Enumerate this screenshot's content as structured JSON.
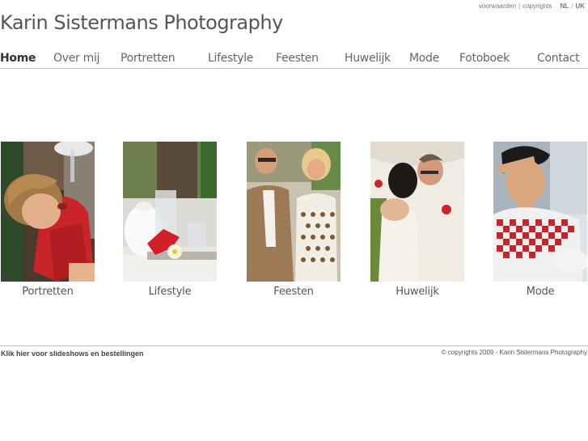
{
  "top_links": {
    "terms": "voorwaarden",
    "copyrights": "copyrights",
    "lang_nl": "NL",
    "lang_uk": "UK",
    "divider": "|",
    "slash": "/"
  },
  "site_title": "Karin Sistermans Photography",
  "nav": {
    "items": [
      {
        "label": "Home",
        "active": true
      },
      {
        "label": "Over mij"
      },
      {
        "label": "Portretten"
      },
      {
        "label": "Lifestyle"
      },
      {
        "label": "Feesten"
      },
      {
        "label": "Huwelijk"
      },
      {
        "label": "Mode"
      },
      {
        "label": "Fotoboek"
      },
      {
        "label": "Contact"
      }
    ]
  },
  "gallery": [
    {
      "caption": "Portretten"
    },
    {
      "caption": "Lifestyle"
    },
    {
      "caption": "Feesten"
    },
    {
      "caption": "Huwelijk"
    },
    {
      "caption": "Mode"
    }
  ],
  "footer": {
    "slideshows_link": "Klik hier voor slideshows en bestellingen",
    "copyright": "© copyrights  2009 - Karin Sistermans Photography"
  }
}
